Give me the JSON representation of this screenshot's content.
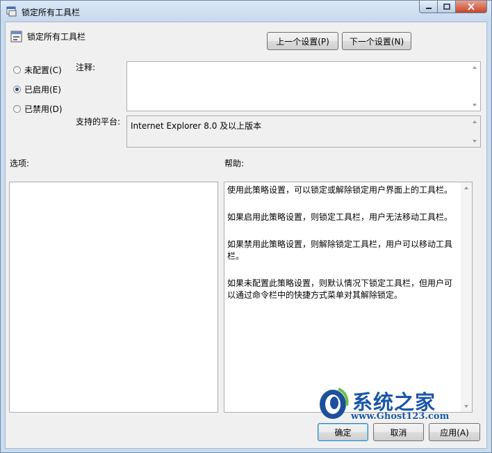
{
  "window": {
    "title": "锁定所有工具栏"
  },
  "header": {
    "setting_name": "锁定所有工具栏"
  },
  "nav": {
    "prev_label": "上一个设置(P)",
    "next_label": "下一个设置(N)"
  },
  "state": {
    "options": [
      {
        "label": "未配置(C)",
        "selected": false
      },
      {
        "label": "已启用(E)",
        "selected": true
      },
      {
        "label": "已禁用(D)",
        "selected": false
      }
    ]
  },
  "comment": {
    "label": "注释:",
    "value": ""
  },
  "platform": {
    "label": "支持的平台:",
    "value": "Internet Explorer 8.0 及以上版本"
  },
  "options_panel": {
    "label": "选项:"
  },
  "help_panel": {
    "label": "帮助:",
    "paragraphs": [
      "使用此策略设置，可以锁定或解除锁定用户界面上的工具栏。",
      "如果启用此策略设置，则锁定工具栏，用户无法移动工具栏。",
      "如果禁用此策略设置，则解除锁定工具栏，用户可以移动工具栏。",
      "如果未配置此策略设置，则默认情况下锁定工具栏，但用户可以通过命令栏中的快捷方式菜单对其解除锁定。"
    ]
  },
  "footer": {
    "ok_label": "确定",
    "cancel_label": "取消",
    "apply_label": "应用(A)"
  },
  "watermark": {
    "brand": "系统之家",
    "url": "www.Ghost123.com"
  },
  "colors": {
    "title_bar": "#c7d9ee",
    "client_bg": "#f0f0f0",
    "close_button": "#c7452d",
    "watermark_blue": "#1a56a8"
  }
}
